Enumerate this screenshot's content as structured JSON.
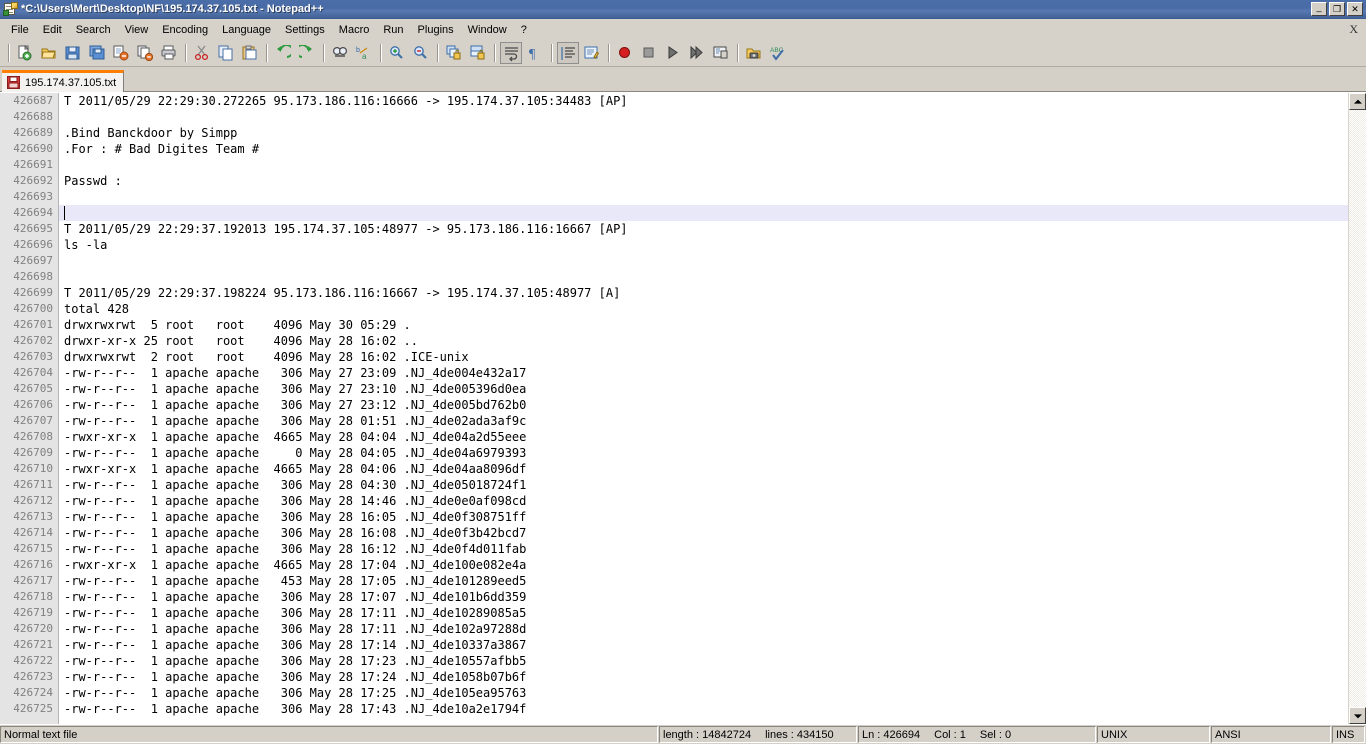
{
  "window": {
    "title": "*C:\\Users\\Mert\\Desktop\\NF\\195.174.37.105.txt - Notepad++",
    "icon": "notepad-plus-plus-icon",
    "minimize_label": "_",
    "restore_label": "❐",
    "close_label": "✕",
    "title_gradient_start": "#4a6ea9",
    "title_gradient_end": "#416296"
  },
  "menu": {
    "items": [
      {
        "label": "File"
      },
      {
        "label": "Edit"
      },
      {
        "label": "Search"
      },
      {
        "label": "View"
      },
      {
        "label": "Encoding"
      },
      {
        "label": "Language"
      },
      {
        "label": "Settings"
      },
      {
        "label": "Macro"
      },
      {
        "label": "Run"
      },
      {
        "label": "Plugins"
      },
      {
        "label": "Window"
      },
      {
        "label": "?"
      }
    ],
    "close_document_label": "X"
  },
  "toolbar": {
    "groups": [
      [
        "new-file-icon",
        "open-file-icon",
        "save-icon",
        "save-all-icon",
        "close-file-icon",
        "close-all-files-icon",
        "print-icon"
      ],
      [
        "cut-icon",
        "copy-icon",
        "paste-icon"
      ],
      [
        "undo-icon",
        "redo-icon"
      ],
      [
        "find-icon",
        "replace-icon"
      ],
      [
        "zoom-in-icon",
        "zoom-out-icon"
      ],
      [
        "sync-vertical-scroll-icon",
        "sync-horizontal-scroll-icon"
      ],
      [
        "word-wrap-icon",
        "show-all-characters-icon"
      ],
      [
        "indent-guideline-icon",
        "user-defined-language-icon"
      ],
      [
        "record-macro-icon",
        "stop-recording-icon",
        "play-macro-icon",
        "run-macro-multiple-icon",
        "save-macro-icon"
      ],
      [
        "run-icon",
        "spell-check-icon"
      ]
    ]
  },
  "tabs": [
    {
      "label": "195.174.37.105.txt",
      "icon": "unsaved-floppy-icon",
      "active": true,
      "modified": true,
      "accent_color": "#ff8000"
    }
  ],
  "editor": {
    "first_line_number": 426687,
    "current_line_number": 426694,
    "lines": [
      {
        "num": "426687",
        "text": "T 2011/05/29 22:29:30.272265 95.173.186.116:16666 -> 195.174.37.105:34483 [AP]"
      },
      {
        "num": "426688",
        "text": ""
      },
      {
        "num": "426689",
        "text": ".Bind Banckdoor by Simpp"
      },
      {
        "num": "426690",
        "text": ".For : # Bad Digites Team #"
      },
      {
        "num": "426691",
        "text": ""
      },
      {
        "num": "426692",
        "text": "Passwd :"
      },
      {
        "num": "426693",
        "text": ""
      },
      {
        "num": "426694",
        "text": ""
      },
      {
        "num": "426695",
        "text": "T 2011/05/29 22:29:37.192013 195.174.37.105:48977 -> 95.173.186.116:16667 [AP]"
      },
      {
        "num": "426696",
        "text": "ls -la"
      },
      {
        "num": "426697",
        "text": ""
      },
      {
        "num": "426698",
        "text": ""
      },
      {
        "num": "426699",
        "text": "T 2011/05/29 22:29:37.198224 95.173.186.116:16667 -> 195.174.37.105:48977 [A]"
      },
      {
        "num": "426700",
        "text": "total 428"
      },
      {
        "num": "426701",
        "text": "drwxrwxrwt  5 root   root    4096 May 30 05:29 ."
      },
      {
        "num": "426702",
        "text": "drwxr-xr-x 25 root   root    4096 May 28 16:02 .."
      },
      {
        "num": "426703",
        "text": "drwxrwxrwt  2 root   root    4096 May 28 16:02 .ICE-unix"
      },
      {
        "num": "426704",
        "text": "-rw-r--r--  1 apache apache   306 May 27 23:09 .NJ_4de004e432a17"
      },
      {
        "num": "426705",
        "text": "-rw-r--r--  1 apache apache   306 May 27 23:10 .NJ_4de005396d0ea"
      },
      {
        "num": "426706",
        "text": "-rw-r--r--  1 apache apache   306 May 27 23:12 .NJ_4de005bd762b0"
      },
      {
        "num": "426707",
        "text": "-rw-r--r--  1 apache apache   306 May 28 01:51 .NJ_4de02ada3af9c"
      },
      {
        "num": "426708",
        "text": "-rwxr-xr-x  1 apache apache  4665 May 28 04:04 .NJ_4de04a2d55eee"
      },
      {
        "num": "426709",
        "text": "-rw-r--r--  1 apache apache     0 May 28 04:05 .NJ_4de04a6979393"
      },
      {
        "num": "426710",
        "text": "-rwxr-xr-x  1 apache apache  4665 May 28 04:06 .NJ_4de04aa8096df"
      },
      {
        "num": "426711",
        "text": "-rw-r--r--  1 apache apache   306 May 28 04:30 .NJ_4de05018724f1"
      },
      {
        "num": "426712",
        "text": "-rw-r--r--  1 apache apache   306 May 28 14:46 .NJ_4de0e0af098cd"
      },
      {
        "num": "426713",
        "text": "-rw-r--r--  1 apache apache   306 May 28 16:05 .NJ_4de0f308751ff"
      },
      {
        "num": "426714",
        "text": "-rw-r--r--  1 apache apache   306 May 28 16:08 .NJ_4de0f3b42bcd7"
      },
      {
        "num": "426715",
        "text": "-rw-r--r--  1 apache apache   306 May 28 16:12 .NJ_4de0f4d011fab"
      },
      {
        "num": "426716",
        "text": "-rwxr-xr-x  1 apache apache  4665 May 28 17:04 .NJ_4de100e082e4a"
      },
      {
        "num": "426717",
        "text": "-rw-r--r--  1 apache apache   453 May 28 17:05 .NJ_4de101289eed5"
      },
      {
        "num": "426718",
        "text": "-rw-r--r--  1 apache apache   306 May 28 17:07 .NJ_4de101b6dd359"
      },
      {
        "num": "426719",
        "text": "-rw-r--r--  1 apache apache   306 May 28 17:11 .NJ_4de10289085a5"
      },
      {
        "num": "426720",
        "text": "-rw-r--r--  1 apache apache   306 May 28 17:11 .NJ_4de102a97288d"
      },
      {
        "num": "426721",
        "text": "-rw-r--r--  1 apache apache   306 May 28 17:14 .NJ_4de10337a3867"
      },
      {
        "num": "426722",
        "text": "-rw-r--r--  1 apache apache   306 May 28 17:23 .NJ_4de10557afbb5"
      },
      {
        "num": "426723",
        "text": "-rw-r--r--  1 apache apache   306 May 28 17:24 .NJ_4de1058b07b6f"
      },
      {
        "num": "426724",
        "text": "-rw-r--r--  1 apache apache   306 May 28 17:25 .NJ_4de105ea95763"
      },
      {
        "num": "426725",
        "text": "-rw-r--r--  1 apache apache   306 May 28 17:43 .NJ_4de10a2e1794f"
      }
    ],
    "current_line_bg": "#e8e8f8",
    "gutter_bg": "#e4e4e4",
    "background": "#ffffff"
  },
  "scrollbar": {
    "up_arrow": "scroll-up-arrow-icon",
    "down_arrow": "scroll-down-arrow-icon",
    "thumb_top_pct": 0,
    "thumb_height_pct": 4
  },
  "statusbar": {
    "file_type": "Normal text file",
    "length_label": "length : 14842724",
    "lines_label": "lines : 434150",
    "ln_label": "Ln : 426694",
    "col_label": "Col : 1",
    "sel_label": "Sel : 0",
    "eol": "UNIX",
    "encoding": "ANSI",
    "insert_mode": "INS"
  }
}
